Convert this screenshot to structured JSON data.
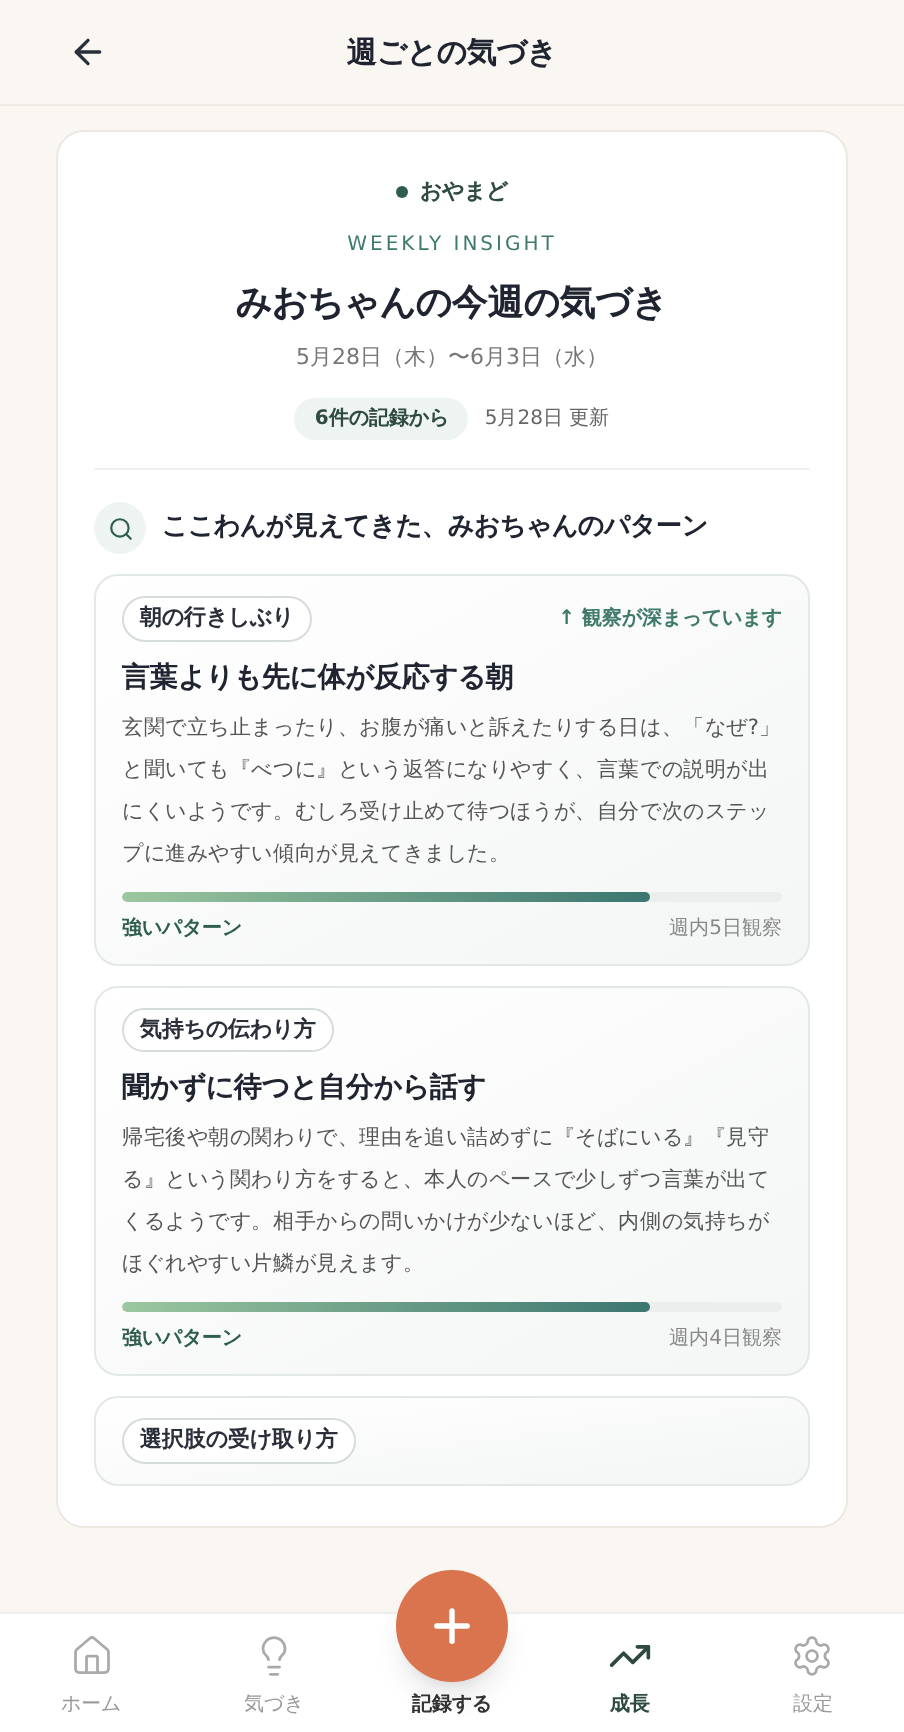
{
  "header": {
    "title": "週ごとの気づき"
  },
  "insight": {
    "badge": "おやまど",
    "eyebrow": "WEEKLY INSIGHT",
    "title": "みおちゃんの今週の気づき",
    "period": "5月28日（木）〜6月3日（水）",
    "source_chip": "6件の記録から",
    "updated": "5月28日 更新"
  },
  "section_title": "ここわんが見えてきた、みおちゃんのパターン",
  "patterns": [
    {
      "tag": "朝の行きしぶり",
      "trend": "↑ 観察が深まっています",
      "title": "言葉よりも先に体が反応する朝",
      "body": "玄関で立ち止まったり、お腹が痛いと訴えたりする日は、「なぜ?」と聞いても『べつに』という返答になりやすく、言葉での説明が出にくいようです。むしろ受け止めて待つほうが、自分で次のステップに進みやすい傾向が見えてきました。",
      "level": 0.8,
      "strength": "強いパターン",
      "observed": "週内5日観察"
    },
    {
      "tag": "気持ちの伝わり方",
      "title": "聞かずに待つと自分から話す",
      "body": "帰宅後や朝の関わりで、理由を追い詰めずに『そばにいる』『見守る』という関わり方をすると、本人のペースで少しずつ言葉が出てくるようです。相手からの問いかけが少ないほど、内側の気持ちがほぐれやすい片鱗が見えます。",
      "level": 0.8,
      "strength": "強いパターン",
      "observed": "週内4日観察"
    },
    {
      "tag": "選択肢の受け取り方"
    }
  ],
  "nav": [
    {
      "kind": "home",
      "label": "ホーム",
      "selected": false
    },
    {
      "kind": "idea",
      "label": "気づき",
      "selected": false
    },
    {
      "kind": "fab",
      "label": "記録する",
      "selected": false
    },
    {
      "kind": "growth",
      "label": "成長",
      "selected": true
    },
    {
      "kind": "settings",
      "label": "設定",
      "selected": false
    }
  ]
}
